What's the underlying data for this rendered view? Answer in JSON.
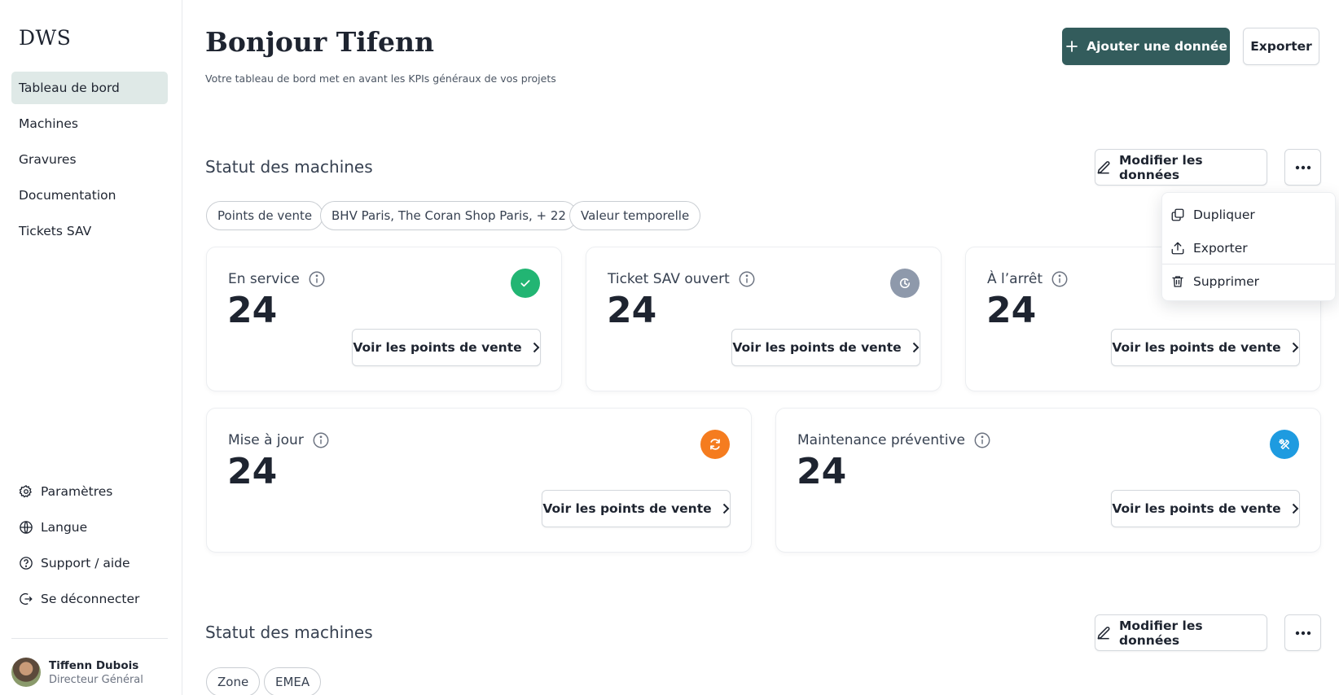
{
  "app": {
    "logo": "DWS"
  },
  "sidebar": {
    "items": [
      {
        "label": "Tableau de bord"
      },
      {
        "label": "Machines"
      },
      {
        "label": "Gravures"
      },
      {
        "label": "Documentation"
      },
      {
        "label": "Tickets SAV"
      }
    ],
    "utilities": [
      {
        "label": "Paramètres",
        "icon": "gear-icon"
      },
      {
        "label": "Langue",
        "icon": "globe-icon"
      },
      {
        "label": "Support / aide",
        "icon": "help-icon"
      },
      {
        "label": "Se déconnecter",
        "icon": "logout-icon"
      }
    ],
    "user": {
      "name": "Tiffenn Dubois",
      "role": "Directeur Général"
    }
  },
  "header": {
    "title": "Bonjour Tifenn",
    "subtitle": "Votre tableau de bord met en avant les KPIs généraux de vos projets",
    "add_label": "Ajouter une donnée",
    "export_label": "Exporter"
  },
  "sections": [
    {
      "title": "Statut des machines",
      "edit_label": "Modifier les données",
      "chips": [
        "Points de vente",
        "BHV Paris, The Coran Shop Paris, + 22",
        "Valeur temporelle"
      ],
      "cards": [
        {
          "label": "En service",
          "value": "24",
          "button": "Voir les points de vente",
          "status_icon": "check-icon",
          "color": "#22b573"
        },
        {
          "label": "Ticket SAV ouvert",
          "value": "24",
          "button": "Voir les points de vente",
          "status_icon": "clock-icon",
          "color": "#8e99ab"
        },
        {
          "label": "À l’arrêt",
          "value": "24",
          "button": "Voir les points de vente",
          "status_icon": "stop-icon",
          "color": "#e5484d"
        },
        {
          "label": "Mise à jour",
          "value": "24",
          "button": "Voir les points de vente",
          "status_icon": "refresh-icon",
          "color": "#f57c1f"
        },
        {
          "label": "Maintenance préventive",
          "value": "24",
          "button": "Voir les points de vente",
          "status_icon": "tools-icon",
          "color": "#1e9be0"
        }
      ]
    },
    {
      "title": "Statut des machines",
      "edit_label": "Modifier les données",
      "chips": [
        "Zone",
        "EMEA"
      ]
    }
  ],
  "menu": {
    "items": [
      {
        "label": "Dupliquer",
        "icon": "copy-icon"
      },
      {
        "label": "Exporter",
        "icon": "upload-icon"
      },
      {
        "label": "Supprimer",
        "icon": "trash-icon"
      }
    ]
  },
  "colors": {
    "primary": "#335c5c",
    "active_nav": "#dfe9e7"
  }
}
